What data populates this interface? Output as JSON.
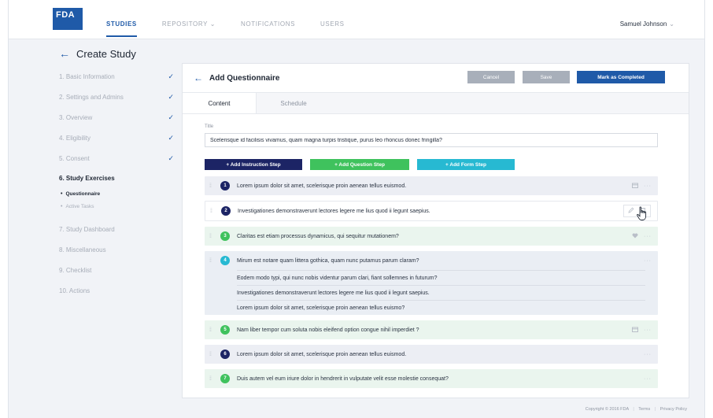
{
  "header": {
    "logo": "FDA",
    "nav": [
      {
        "label": "STUDIES",
        "active": true
      },
      {
        "label": "REPOSITORY ⌄",
        "active": false
      },
      {
        "label": "NOTIFICATIONS",
        "active": false
      },
      {
        "label": "USERS",
        "active": false
      }
    ],
    "user": "Samuel Johnson",
    "user_chevron": "⌄"
  },
  "page": {
    "back_arrow": "←",
    "title": "Create Study"
  },
  "sidebar": {
    "items": [
      {
        "label": "1.  Basic Information",
        "done": true
      },
      {
        "label": "2.  Settings and Admins",
        "done": true
      },
      {
        "label": "3.  Overview",
        "done": true
      },
      {
        "label": "4.  Eligibility",
        "done": true
      },
      {
        "label": "5.  Consent",
        "done": true
      },
      {
        "label": "6.  Study Exercises",
        "done": false,
        "current": true
      },
      {
        "label": "7.  Study Dashboard",
        "done": false
      },
      {
        "label": "8.  Miscellaneous",
        "done": false
      },
      {
        "label": "9.  Checklist",
        "done": false
      },
      {
        "label": "10.  Actions",
        "done": false
      }
    ],
    "sub_items": [
      {
        "label": "Questionnaire",
        "active": true
      },
      {
        "label": "Active Tasks",
        "active": false
      }
    ],
    "check_glyph": "✓",
    "bullet_glyph": "•"
  },
  "card": {
    "back_arrow": "←",
    "title": "Add Questionnaire",
    "buttons": {
      "cancel": "Cancel",
      "save": "Save",
      "mark": "Mark as Completed"
    },
    "tabs": [
      {
        "label": "Content",
        "active": true
      },
      {
        "label": "Schedule",
        "active": false
      }
    ],
    "title_label": "Title",
    "title_value": "Scelerisque id facilisis vivamus, quam magna turpis tristique, purus leo rhoncus donec fringilla?",
    "add_buttons": {
      "instruction": "+ Add Instruction Step",
      "question": "+ Add Question Step",
      "form": "+ Add Form Step"
    },
    "steps": [
      {
        "num": "1",
        "type": "instr",
        "text": "Lorem ipsum dolor sit amet, scelerisque proin aenean tellus euismod."
      },
      {
        "num": "2",
        "type": "instr",
        "text": "Investigationes demonstraverunt lectores legere me lius quod ii legunt saepius."
      },
      {
        "num": "3",
        "type": "quest",
        "text": "Claritas est etiam processus dynamicus, qui sequitur mutationem?"
      },
      {
        "num": "4",
        "type": "form",
        "text": "Mirum est notare quam littera gothica, quam nunc putamus parum claram?",
        "sub": [
          "Eodem modo typi, qui nunc nobis videntur parum clari, fiant sollemnes in futurum?",
          "Investigationes demonstraverunt lectores legere me lius quod ii legunt saepius.",
          "Lorem ipsum dolor sit amet, scelerisque proin aenean tellus euismo?"
        ]
      },
      {
        "num": "5",
        "type": "quest",
        "text": "Nam liber tempor cum soluta nobis eleifend option congue nihil imperdiet ?"
      },
      {
        "num": "6",
        "type": "instr",
        "text": "Lorem ipsum dolor sit amet, scelerisque proin aenean tellus euismod."
      },
      {
        "num": "7",
        "type": "quest",
        "text": "Duis autem vel eum iriure dolor in hendrerit in vulputate velit esse molestie consequat?"
      }
    ],
    "handle_glyph": "⁞⁞",
    "more_glyph": "···"
  },
  "footer": {
    "copyright": "Copyright © 2016 FDA",
    "terms": "Terms",
    "privacy": "Privacy Policy",
    "separator": "|"
  },
  "colors": {
    "brand": "#1f5aa8",
    "instruction": "#1c2465",
    "question": "#3fc25d",
    "form": "#27b9d2"
  }
}
